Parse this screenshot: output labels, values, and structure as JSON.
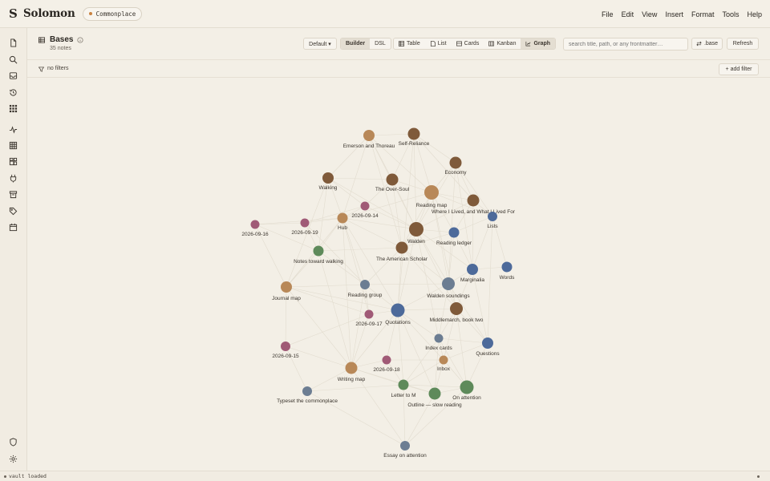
{
  "app": {
    "name": "Solomon",
    "vault": "Commonplace",
    "menu": [
      "File",
      "Edit",
      "View",
      "Insert",
      "Format",
      "Tools",
      "Help"
    ]
  },
  "rail": {
    "icons": [
      "file-icon",
      "search-icon",
      "inbox-icon",
      "history-icon",
      "grid-icon",
      "activity-icon",
      "table-icon",
      "extensions-icon",
      "plugin-icon",
      "archive-icon",
      "tag-icon",
      "calendar-icon",
      "shield-icon",
      "settings-icon"
    ]
  },
  "header": {
    "title": "Bases",
    "note_count": "35 notes",
    "view_select": "Default ▾",
    "mode": {
      "options": [
        "Builder",
        "DSL"
      ],
      "active": "Builder"
    },
    "layouts": [
      {
        "label": "Table",
        "icon": "table-icon"
      },
      {
        "label": "List",
        "icon": "list-icon"
      },
      {
        "label": "Cards",
        "icon": "cards-icon"
      },
      {
        "label": "Kanban",
        "icon": "kanban-icon"
      },
      {
        "label": "Graph",
        "icon": "graph-icon",
        "active": true
      }
    ],
    "search_placeholder": "search title, path, or any frontmatter…",
    "base_button": ".base",
    "refresh_button": "Refresh"
  },
  "filters": {
    "status": "no filters",
    "add_filter": "+ add filter"
  },
  "graph": {
    "colors": {
      "brown": "#7f5a3a",
      "tan": "#b88858",
      "blue": "#4d6a9a",
      "slate": "#6c7d92",
      "mauve": "#a05a76",
      "green": "#5e8a5a",
      "edge": "#e2dccf"
    },
    "nodes": [
      {
        "id": "emerson",
        "label": "Emerson and Thoreau",
        "color": "tan"
      },
      {
        "id": "selfreliance",
        "label": "Self-Reliance",
        "color": "brown"
      },
      {
        "id": "economy",
        "label": "Economy",
        "color": "brown"
      },
      {
        "id": "walking",
        "label": "Walking",
        "color": "brown"
      },
      {
        "id": "oversoul",
        "label": "The Over-Soul",
        "color": "brown"
      },
      {
        "id": "readingmap",
        "label": "Reading map",
        "color": "tan"
      },
      {
        "id": "wherelived",
        "label": "Where I Lived, and What I Lived For",
        "color": "brown"
      },
      {
        "id": "d0914",
        "label": "2026-09-14",
        "color": "mauve"
      },
      {
        "id": "lists",
        "label": "Lists",
        "color": "blue"
      },
      {
        "id": "d0916",
        "label": "2026-09-16",
        "color": "mauve"
      },
      {
        "id": "d0919",
        "label": "2026-09-19",
        "color": "mauve"
      },
      {
        "id": "hub",
        "label": "Hub",
        "color": "tan"
      },
      {
        "id": "walden",
        "label": "Walden",
        "color": "brown"
      },
      {
        "id": "ledger",
        "label": "Reading ledger",
        "color": "blue"
      },
      {
        "id": "notes",
        "label": "Notes toward walking",
        "color": "green"
      },
      {
        "id": "scholar",
        "label": "The American Scholar",
        "color": "brown"
      },
      {
        "id": "marginalia",
        "label": "Marginalia",
        "color": "blue"
      },
      {
        "id": "words",
        "label": "Words",
        "color": "blue"
      },
      {
        "id": "journal",
        "label": "Journal map",
        "color": "tan"
      },
      {
        "id": "rgroup",
        "label": "Reading group",
        "color": "slate"
      },
      {
        "id": "soundings",
        "label": "Walden soundings",
        "color": "slate"
      },
      {
        "id": "d0917",
        "label": "2026-09-17",
        "color": "mauve"
      },
      {
        "id": "quotations",
        "label": "Quotations",
        "color": "blue"
      },
      {
        "id": "middlemarch",
        "label": "Middlemarch, book two",
        "color": "brown"
      },
      {
        "id": "indexcards",
        "label": "Index cards",
        "color": "slate"
      },
      {
        "id": "questions",
        "label": "Questions",
        "color": "blue"
      },
      {
        "id": "d0915",
        "label": "2026-09-15",
        "color": "mauve"
      },
      {
        "id": "d0918",
        "label": "2026-09-18",
        "color": "mauve"
      },
      {
        "id": "inbox",
        "label": "Inbox",
        "color": "tan"
      },
      {
        "id": "writingmap",
        "label": "Writing map",
        "color": "tan"
      },
      {
        "id": "letter",
        "label": "Letter to M",
        "color": "green"
      },
      {
        "id": "outline",
        "label": "Outline — slow reading",
        "color": "green"
      },
      {
        "id": "onattention",
        "label": "On attention",
        "color": "green"
      },
      {
        "id": "typeset",
        "label": "Typeset the commonplace",
        "color": "slate"
      },
      {
        "id": "essay",
        "label": "Essay on attention",
        "color": "slate"
      }
    ],
    "edges": [
      [
        "emerson",
        "selfreliance"
      ],
      [
        "emerson",
        "oversoul"
      ],
      [
        "emerson",
        "walking"
      ],
      [
        "emerson",
        "readingmap"
      ],
      [
        "emerson",
        "scholar"
      ],
      [
        "emerson",
        "walden"
      ],
      [
        "emerson",
        "hub"
      ],
      [
        "selfreliance",
        "economy"
      ],
      [
        "selfreliance",
        "readingmap"
      ],
      [
        "selfreliance",
        "oversoul"
      ],
      [
        "selfreliance",
        "walden"
      ],
      [
        "selfreliance",
        "wherelived"
      ],
      [
        "selfreliance",
        "quotations"
      ],
      [
        "economy",
        "readingmap"
      ],
      [
        "economy",
        "wherelived"
      ],
      [
        "economy",
        "walden"
      ],
      [
        "economy",
        "lists"
      ],
      [
        "economy",
        "marginalia"
      ],
      [
        "economy",
        "soundings"
      ],
      [
        "walking",
        "oversoul"
      ],
      [
        "walking",
        "notes"
      ],
      [
        "walking",
        "hub"
      ],
      [
        "walking",
        "d0914"
      ],
      [
        "walking",
        "journal"
      ],
      [
        "walking",
        "walden"
      ],
      [
        "oversoul",
        "readingmap"
      ],
      [
        "oversoul",
        "walden"
      ],
      [
        "oversoul",
        "scholar"
      ],
      [
        "oversoul",
        "d0914"
      ],
      [
        "readingmap",
        "wherelived"
      ],
      [
        "readingmap",
        "walden"
      ],
      [
        "readingmap",
        "ledger"
      ],
      [
        "readingmap",
        "scholar"
      ],
      [
        "readingmap",
        "soundings"
      ],
      [
        "readingmap",
        "middlemarch"
      ],
      [
        "readingmap",
        "lists"
      ],
      [
        "readingmap",
        "hub"
      ],
      [
        "wherelived",
        "lists"
      ],
      [
        "wherelived",
        "walden"
      ],
      [
        "wherelived",
        "ledger"
      ],
      [
        "wherelived",
        "marginalia"
      ],
      [
        "d0914",
        "hub"
      ],
      [
        "d0914",
        "d0919"
      ],
      [
        "d0914",
        "walden"
      ],
      [
        "lists",
        "ledger"
      ],
      [
        "lists",
        "words"
      ],
      [
        "lists",
        "marginalia"
      ],
      [
        "lists",
        "questions"
      ],
      [
        "d0916",
        "d0919"
      ],
      [
        "d0916",
        "notes"
      ],
      [
        "d0916",
        "journal"
      ],
      [
        "d0916",
        "hub"
      ],
      [
        "d0919",
        "hub"
      ],
      [
        "d0919",
        "notes"
      ],
      [
        "d0919",
        "rgroup"
      ],
      [
        "hub",
        "walden"
      ],
      [
        "hub",
        "notes"
      ],
      [
        "hub",
        "journal"
      ],
      [
        "hub",
        "scholar"
      ],
      [
        "hub",
        "quotations"
      ],
      [
        "hub",
        "rgroup"
      ],
      [
        "hub",
        "writingmap"
      ],
      [
        "hub",
        "d0917"
      ],
      [
        "walden",
        "scholar"
      ],
      [
        "walden",
        "ledger"
      ],
      [
        "walden",
        "soundings"
      ],
      [
        "walden",
        "quotations"
      ],
      [
        "walden",
        "marginalia"
      ],
      [
        "walden",
        "middlemarch"
      ],
      [
        "walden",
        "indexcards"
      ],
      [
        "ledger",
        "marginalia"
      ],
      [
        "ledger",
        "soundings"
      ],
      [
        "ledger",
        "scholar"
      ],
      [
        "notes",
        "journal"
      ],
      [
        "notes",
        "rgroup"
      ],
      [
        "notes",
        "writingmap"
      ],
      [
        "notes",
        "scholar"
      ],
      [
        "scholar",
        "soundings"
      ],
      [
        "scholar",
        "quotations"
      ],
      [
        "scholar",
        "rgroup"
      ],
      [
        "scholar",
        "middlemarch"
      ],
      [
        "marginalia",
        "words"
      ],
      [
        "marginalia",
        "soundings"
      ],
      [
        "marginalia",
        "middlemarch"
      ],
      [
        "marginalia",
        "questions"
      ],
      [
        "journal",
        "d0915"
      ],
      [
        "journal",
        "writingmap"
      ],
      [
        "journal",
        "rgroup"
      ],
      [
        "journal",
        "quotations"
      ],
      [
        "journal",
        "d0917"
      ],
      [
        "rgroup",
        "quotations"
      ],
      [
        "rgroup",
        "d0917"
      ],
      [
        "rgroup",
        "soundings"
      ],
      [
        "rgroup",
        "writingmap"
      ],
      [
        "soundings",
        "quotations"
      ],
      [
        "soundings",
        "middlemarch"
      ],
      [
        "soundings",
        "indexcards"
      ],
      [
        "soundings",
        "questions"
      ],
      [
        "d0917",
        "quotations"
      ],
      [
        "d0917",
        "writingmap"
      ],
      [
        "d0917",
        "d0915"
      ],
      [
        "quotations",
        "middlemarch"
      ],
      [
        "quotations",
        "indexcards"
      ],
      [
        "quotations",
        "d0918"
      ],
      [
        "quotations",
        "writingmap"
      ],
      [
        "quotations",
        "letter"
      ],
      [
        "quotations",
        "outline"
      ],
      [
        "quotations",
        "inbox"
      ],
      [
        "middlemarch",
        "indexcards"
      ],
      [
        "middlemarch",
        "questions"
      ],
      [
        "middlemarch",
        "onattention"
      ],
      [
        "middlemarch",
        "inbox"
      ],
      [
        "indexcards",
        "inbox"
      ],
      [
        "indexcards",
        "questions"
      ],
      [
        "indexcards",
        "letter"
      ],
      [
        "indexcards",
        "outline"
      ],
      [
        "indexcards",
        "onattention"
      ],
      [
        "questions",
        "onattention"
      ],
      [
        "questions",
        "inbox"
      ],
      [
        "d0915",
        "writingmap"
      ],
      [
        "d0915",
        "typeset"
      ],
      [
        "d0918",
        "writingmap"
      ],
      [
        "d0918",
        "inbox"
      ],
      [
        "d0918",
        "letter"
      ],
      [
        "inbox",
        "outline"
      ],
      [
        "inbox",
        "onattention"
      ],
      [
        "inbox",
        "letter"
      ],
      [
        "writingmap",
        "typeset"
      ],
      [
        "writingmap",
        "letter"
      ],
      [
        "writingmap",
        "outline"
      ],
      [
        "writingmap",
        "essay"
      ],
      [
        "letter",
        "outline"
      ],
      [
        "letter",
        "onattention"
      ],
      [
        "letter",
        "essay"
      ],
      [
        "outline",
        "onattention"
      ],
      [
        "outline",
        "essay"
      ],
      [
        "onattention",
        "essay"
      ],
      [
        "typeset",
        "essay"
      ],
      [
        "typeset",
        "letter"
      ]
    ]
  },
  "status": {
    "text": "vault loaded"
  }
}
